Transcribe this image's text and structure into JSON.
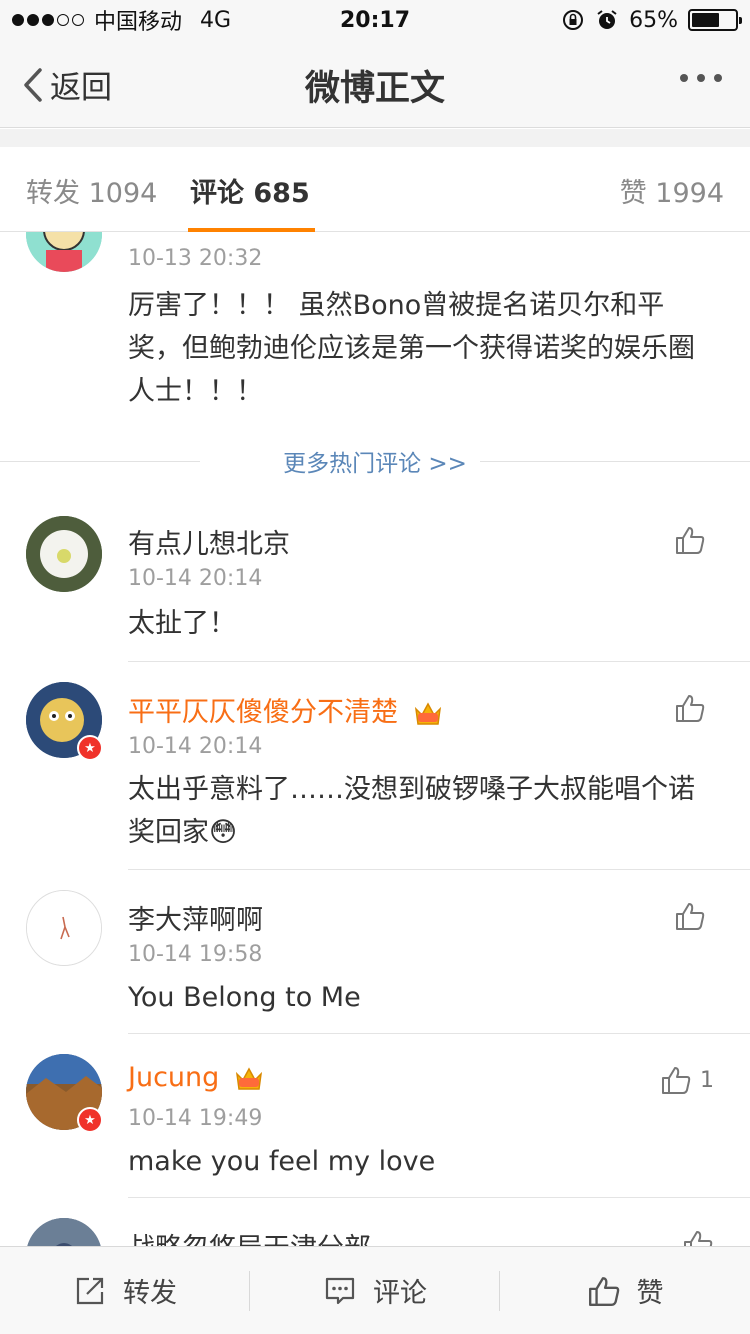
{
  "status_bar": {
    "carrier": "中国移动",
    "network": "4G",
    "time": "20:17",
    "battery_text": "65%",
    "battery_level": 0.65,
    "signal_bars_full": 3,
    "signal_bars_total": 5
  },
  "nav": {
    "back_label": "返回",
    "title": "微博正文",
    "more_icon": "ellipsis-icon"
  },
  "tabs": {
    "repost": "转发 1094",
    "comment": "评论 685",
    "like": "赞 1994"
  },
  "hot_comment": {
    "time": "10-13 20:32",
    "text": "厉害了！！！ 虽然Bono曾被提名诺贝尔和平奖，但鲍勃迪伦应该是第一个获得诺奖的娱乐圈人士！！！"
  },
  "more_hot_label": "更多热门评论 >>",
  "comments": [
    {
      "name": "有点儿想北京",
      "time": "10-14 20:14",
      "text": "太扯了！",
      "vip": false,
      "like_count": ""
    },
    {
      "name": "平平仄仄傻傻分不清楚",
      "time": "10-14 20:14",
      "text": "太出乎意料了……没想到破锣嗓子大叔能唱个诺奖回家😳",
      "vip": true,
      "like_count": ""
    },
    {
      "name": "李大萍啊啊",
      "time": "10-14 19:58",
      "text": "You Belong to Me",
      "vip": false,
      "like_count": ""
    },
    {
      "name": "Jucung",
      "time": "10-14 19:49",
      "text": "make you feel my love",
      "vip": true,
      "like_count": "1"
    },
    {
      "name": "战略忽悠局天津分部",
      "time": "",
      "text": "",
      "vip": false,
      "like_count": ""
    }
  ],
  "toolbar": {
    "repost": "转发",
    "comment": "评论",
    "like": "赞"
  },
  "colors": {
    "accent": "#ff8200",
    "vip_name": "#f86e15",
    "link": "#5b87b8",
    "verified_badge": "#f0322a"
  }
}
